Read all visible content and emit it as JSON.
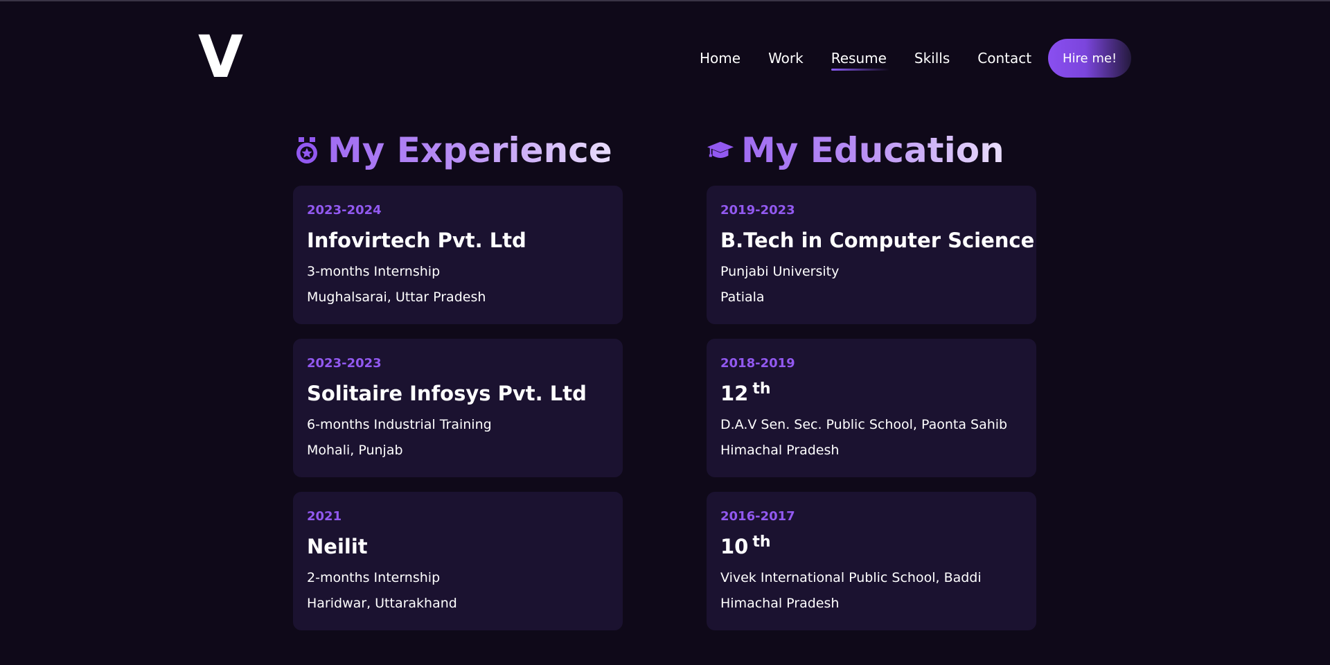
{
  "header": {
    "logo": "V",
    "nav": [
      {
        "label": "Home",
        "active": false
      },
      {
        "label": "Work",
        "active": false
      },
      {
        "label": "Resume",
        "active": true
      },
      {
        "label": "Skills",
        "active": false
      },
      {
        "label": "Contact",
        "active": false
      }
    ],
    "hire_label": "Hire me!"
  },
  "colors": {
    "background": "#0f0919",
    "card": "#1b1230",
    "accent": "#8b5cf6",
    "date": "#9259f0"
  },
  "experience": {
    "heading": "My Experience",
    "icon": "medal-icon",
    "items": [
      {
        "date": "2023-2024",
        "title": "Infovirtech Pvt. Ltd",
        "line1": "3-months Internship",
        "line2": "Mughalsarai, Uttar Pradesh"
      },
      {
        "date": "2023-2023",
        "title": "Solitaire Infosys Pvt. Ltd",
        "line1": "6-months Industrial Training",
        "line2": "Mohali, Punjab"
      },
      {
        "date": "2021",
        "title": "Neilit",
        "line1": "2-months Internship",
        "line2": "Haridwar, Uttarakhand"
      }
    ]
  },
  "education": {
    "heading": "My Education",
    "icon": "graduation-cap-icon",
    "items": [
      {
        "date": "2019-2023",
        "title": "B.Tech in Computer Science",
        "line1": "Punjabi University",
        "line2": "Patiala"
      },
      {
        "date": "2018-2019",
        "title": "12",
        "sup": "th",
        "line1": "D.A.V Sen. Sec. Public School, Paonta Sahib",
        "line2": "Himachal Pradesh"
      },
      {
        "date": "2016-2017",
        "title": "10",
        "sup": "th",
        "line1": "Vivek International Public School, Baddi",
        "line2": "Himachal Pradesh"
      }
    ]
  }
}
